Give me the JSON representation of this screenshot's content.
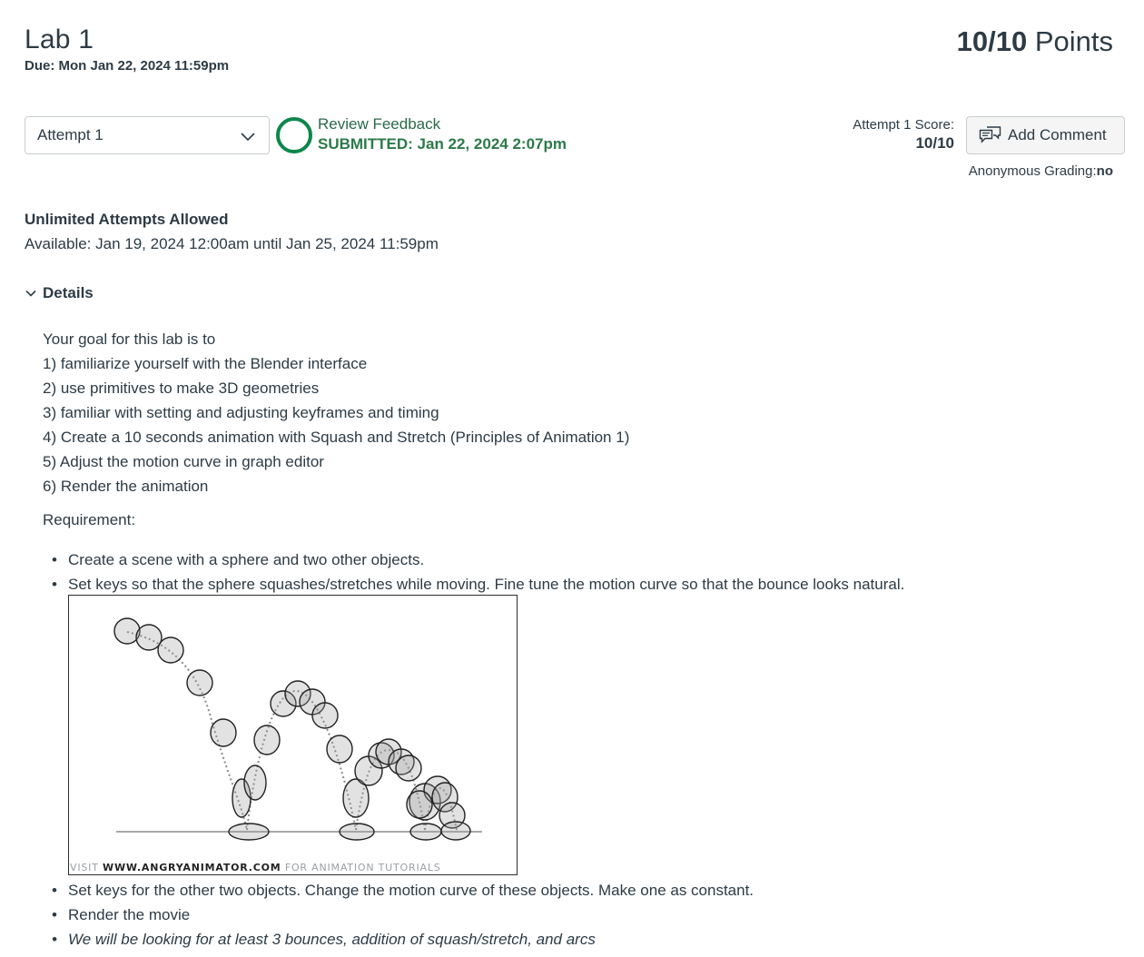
{
  "header": {
    "title": "Lab 1",
    "due": "Due: Mon Jan 22, 2024 11:59pm",
    "points_score": "10/10",
    "points_label": "Points"
  },
  "attempt": {
    "select_value": "Attempt 1",
    "review_link": "Review Feedback",
    "submitted": "SUBMITTED: Jan 22, 2024 2:07pm",
    "score_label": "Attempt 1 Score:",
    "score_value": "10/10",
    "add_comment": "Add Comment",
    "anon_label": "Anonymous Grading:",
    "anon_value": "no"
  },
  "availability": {
    "attempts": "Unlimited Attempts Allowed",
    "available": "Available: Jan 19, 2024 12:00am until Jan 25, 2024 11:59pm"
  },
  "details": {
    "toggle_label": "Details",
    "lines": [
      "Your goal for this lab is to",
      "1) familiarize yourself with the Blender interface",
      "2) use primitives to make 3D geometries",
      "3) familiar with setting and adjusting keyframes and timing",
      "4) Create a 10 seconds animation with Squash and Stretch (Principles of Animation 1)",
      "5) Adjust the motion curve in graph editor",
      "6) Render the animation"
    ],
    "requirement_label": "Requirement:",
    "requirements_top": [
      "Create a scene with a sphere and two other objects.",
      "Set keys so that the sphere squashes/stretches while moving.  Fine tune the motion curve so that the bounce looks natural."
    ],
    "requirements_bottom": [
      "Set keys for the other two objects.  Change the motion curve of these objects.  Make one as constant.",
      "Render the movie",
      "We will be looking for at least 3 bounces, addition of squash/stretch, and arcs"
    ],
    "image_credit_pre": "VISIT ",
    "image_credit_url": "WWW.ANGRYANIMATOR.COM",
    "image_credit_post": " FOR ANIMATION TUTORIALS"
  },
  "colors": {
    "text": "#2d3b45",
    "success": "#0b874b",
    "border": "#c7cdd1"
  }
}
